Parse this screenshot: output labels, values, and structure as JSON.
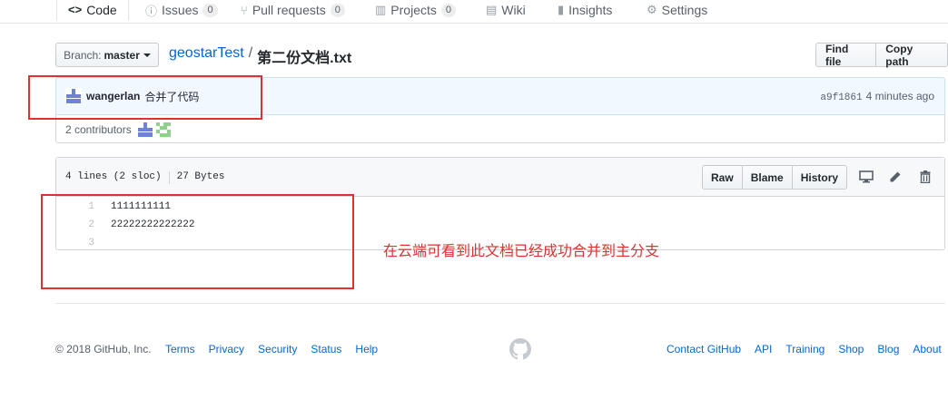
{
  "tabs": [
    {
      "label": "Code",
      "icon": "code-icon",
      "selected": true
    },
    {
      "label": "Issues",
      "icon": "issue-icon",
      "count": "0"
    },
    {
      "label": "Pull requests",
      "icon": "pull-request-icon",
      "count": "0"
    },
    {
      "label": "Projects",
      "icon": "project-icon",
      "count": "0"
    },
    {
      "label": "Wiki",
      "icon": "book-icon"
    },
    {
      "label": "Insights",
      "icon": "graph-icon"
    },
    {
      "label": "Settings",
      "icon": "gear-icon"
    }
  ],
  "branch": {
    "prefix": "Branch:",
    "name": "master"
  },
  "breadcrumb": {
    "repo": "geostarTest",
    "separator": "/",
    "file": "第二份文档.txt"
  },
  "header_actions": {
    "find_file": "Find file",
    "copy_path": "Copy path"
  },
  "commit": {
    "author": "wangerlan",
    "message": "合并了代码",
    "sha": "a9f1861",
    "time": "4 minutes ago"
  },
  "contributors": {
    "label": "2 contributors"
  },
  "file": {
    "lines_info": "4 lines (2 sloc)",
    "size": "27 Bytes",
    "actions": {
      "raw": "Raw",
      "blame": "Blame",
      "history": "History"
    },
    "lines": [
      {
        "num": "1",
        "text": "1111111111"
      },
      {
        "num": "2",
        "text": "22222222222222"
      },
      {
        "num": "3",
        "text": ""
      }
    ]
  },
  "annotation": "在云端可看到此文档已经成功合并到主分支",
  "footer": {
    "copyright": "© 2018 GitHub, Inc.",
    "left_links": [
      "Terms",
      "Privacy",
      "Security",
      "Status",
      "Help"
    ],
    "right_links": [
      "Contact GitHub",
      "API",
      "Training",
      "Shop",
      "Blog",
      "About"
    ]
  },
  "colors": {
    "link": "#0366d6",
    "annotation": "#e03030",
    "selected_tab_accent": "#e36209"
  }
}
